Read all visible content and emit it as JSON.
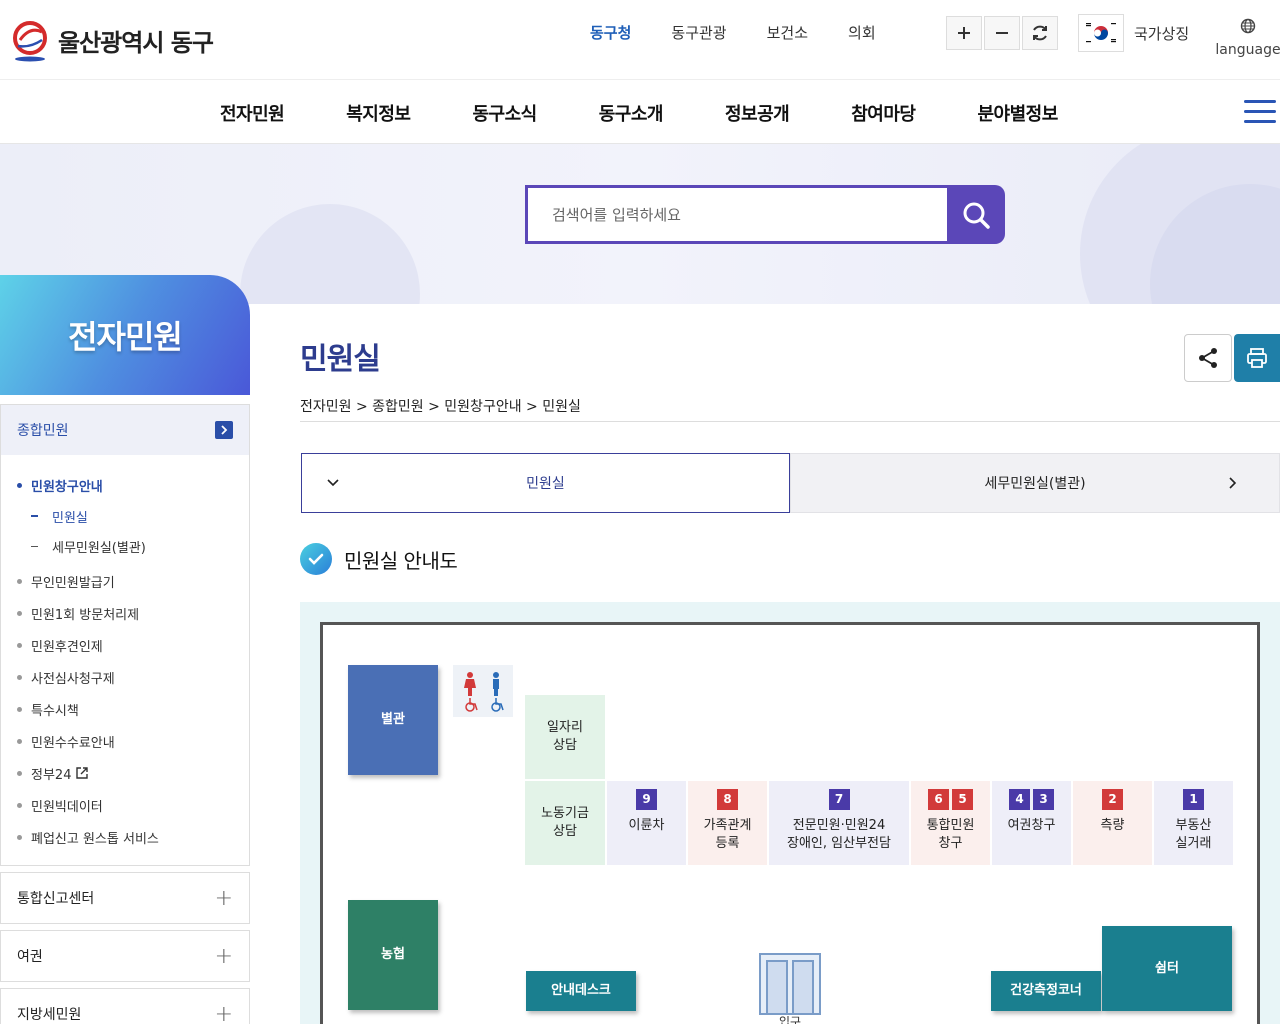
{
  "header": {
    "logo_text": "울산광역시 동구",
    "top_links": [
      "동구청",
      "동구관광",
      "보건소",
      "의회"
    ],
    "national_symbol_label": "국가상징",
    "language_label": "language"
  },
  "gnb": {
    "items": [
      "전자민원",
      "복지정보",
      "동구소식",
      "동구소개",
      "정보공개",
      "참여마당",
      "분야별정보"
    ]
  },
  "search": {
    "placeholder": "검색어를 입력하세요"
  },
  "sidebar": {
    "title": "전자민원",
    "active_group": "종합민원",
    "sub_items": [
      {
        "label": "민원창구안내",
        "level": 2,
        "active": true
      },
      {
        "label": "민원실",
        "level": 3,
        "active": true
      },
      {
        "label": "세무민원실(별관)",
        "level": 3,
        "active": false
      },
      {
        "label": "무인민원발급기",
        "level": 2,
        "active": false
      },
      {
        "label": "민원1회 방문처리제",
        "level": 2,
        "active": false
      },
      {
        "label": "민원후견인제",
        "level": 2,
        "active": false
      },
      {
        "label": "사전심사청구제",
        "level": 2,
        "active": false
      },
      {
        "label": "특수시책",
        "level": 2,
        "active": false
      },
      {
        "label": "민원수수료안내",
        "level": 2,
        "active": false
      },
      {
        "label": "정부24",
        "level": 2,
        "active": false,
        "external": true
      },
      {
        "label": "민원빅데이터",
        "level": 2,
        "active": false
      },
      {
        "label": "폐업신고 원스톱 서비스",
        "level": 2,
        "active": false
      }
    ],
    "groups": [
      "통합신고센터",
      "여권",
      "지방세민원"
    ]
  },
  "content": {
    "page_title": "민원실",
    "breadcrumb": "전자민원 > 종합민원 > 민원창구안내 > 민원실",
    "tabs": [
      "민원실",
      "세무민원실(별관)"
    ],
    "section_title": "민원실 안내도"
  },
  "floor_map": {
    "annex": "별관",
    "job_consult": [
      "일자리",
      "상담"
    ],
    "labor_consult": [
      "노동기금",
      "상담"
    ],
    "nh": "농협",
    "info_desk": "안내데스크",
    "entrance": "입구",
    "health_corner": "건강측정코너",
    "shelter": "쉼터",
    "windows": [
      {
        "nums": [
          "9"
        ],
        "color": "purple",
        "lines": [
          "이륜차"
        ]
      },
      {
        "nums": [
          "8"
        ],
        "color": "red",
        "lines": [
          "가족관계",
          "등록"
        ]
      },
      {
        "nums": [
          "7"
        ],
        "color": "purple",
        "lines": [
          "전문민원·민원24",
          "장애인, 임산부전담"
        ]
      },
      {
        "nums": [
          "6",
          "5"
        ],
        "color": "red",
        "lines": [
          "통합민원",
          "창구"
        ]
      },
      {
        "nums": [
          "4",
          "3"
        ],
        "color": "purple",
        "lines": [
          "여권창구"
        ]
      },
      {
        "nums": [
          "2"
        ],
        "color": "red",
        "lines": [
          "측량"
        ]
      },
      {
        "nums": [
          "1"
        ],
        "color": "purple",
        "lines": [
          "부동산",
          "실거래"
        ]
      }
    ]
  },
  "colors": {
    "primary": "#2d3c8e",
    "search_purple": "#5b47b8",
    "annex_blue": "#4a6fb5",
    "nh_green": "#2e8066",
    "teal": "#1a7f8f"
  }
}
